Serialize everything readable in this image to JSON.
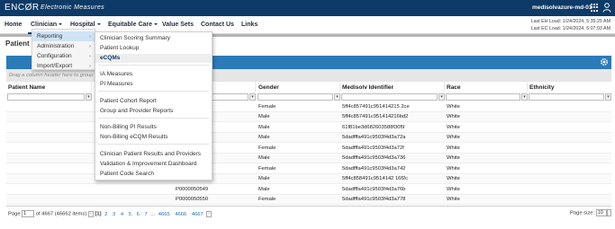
{
  "app": {
    "brand": "ENCØR",
    "brand_sub": "Electronic Measures",
    "user": "medisolvazure-md-01"
  },
  "nav": {
    "items": [
      "Home",
      "Clinician",
      "Hospital",
      "Equitable Care",
      "Value Sets",
      "Contact Us",
      "Links"
    ]
  },
  "load_info": {
    "eh": "Last EH Load: 1/24/2024, 5:35:25 AM",
    "ec": "Last EC Load: 1/24/2024, 6:07:03 AM"
  },
  "page": {
    "title": "Patient",
    "group_hint": "Drag a column header here to group by that column"
  },
  "clinician_menu": {
    "items": [
      "Reporting",
      "Administration",
      "Configuration",
      "Import/Export"
    ]
  },
  "reporting_submenu": {
    "items": [
      "Clinician Scoring Summary",
      "Patient Lookup",
      "eCQMs",
      "IA Measures",
      "PI Measures",
      "Patient Cohort Report",
      "Group and Provider Reports",
      "Non-Billing PI Results",
      "Non-Billing eCQM Results",
      "Clinician Patient Results and Providers",
      "Validation & Improvement Dashboard",
      "Patient Code Search"
    ]
  },
  "grid": {
    "columns": [
      "Patient Name",
      "r",
      "Gender",
      "Medisolv Identifier",
      "Race",
      "Ethnicity"
    ],
    "rows": [
      {
        "name": "",
        "id": "",
        "gender": "Female",
        "mid": "5ff4c857491c951414215 2ce",
        "race": "White",
        "eth": ""
      },
      {
        "name": "",
        "id": "",
        "gender": "Male",
        "mid": "5ff4c857491c951414216bd2",
        "race": "White",
        "eth": ""
      },
      {
        "name": "",
        "id": "",
        "gender": "Male",
        "mid": "61f81be3d682603588f30f9",
        "race": "White",
        "eth": ""
      },
      {
        "name": "",
        "id": "",
        "gender": "Male",
        "mid": "5dadfffa491c9503f4d3a72a",
        "race": "White",
        "eth": ""
      },
      {
        "name": "",
        "id": "",
        "gender": "Female",
        "mid": "5dadfffa491c9503f4d3a72f",
        "race": "White",
        "eth": ""
      },
      {
        "name": "",
        "id": "",
        "gender": "Male",
        "mid": "5dadfffa491c9503f4d3a736",
        "race": "White",
        "eth": ""
      },
      {
        "name": "",
        "id": "",
        "gender": "Female",
        "mid": "5dadfffa491c9503f4d3a742",
        "race": "White",
        "eth": ""
      },
      {
        "name": "",
        "id": "",
        "gender": "Male",
        "mid": "5ff4c858491c9514142 16f2c",
        "race": "White",
        "eth": ""
      },
      {
        "name": "",
        "id": "P0000050549",
        "gender": "Male",
        "mid": "5dadfffa491c9503f4d3a76b",
        "race": "White",
        "eth": ""
      },
      {
        "name": "",
        "id": "P0000050550",
        "gender": "Female",
        "mid": "5dadfffa491c9503f4d3a778",
        "race": "White",
        "eth": ""
      }
    ]
  },
  "pager": {
    "page_label": "Page",
    "page_value": "1",
    "of_text": "of 4667 (46662 items)",
    "pages": [
      "[1]",
      "2",
      "3",
      "4",
      "5",
      "6",
      "7",
      "...",
      "4665",
      "4666",
      "4667"
    ],
    "page_size_label": "Page size:",
    "page_size_value": "10"
  }
}
